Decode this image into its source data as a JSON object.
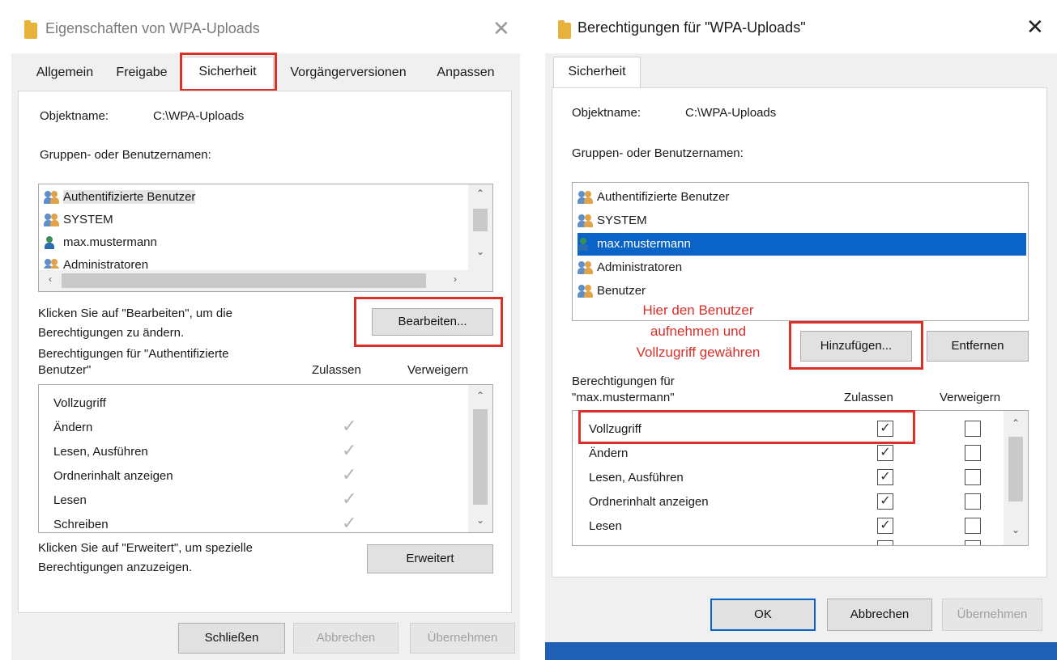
{
  "left_dialog": {
    "title": "Eigenschaften von WPA-Uploads",
    "tabs": [
      "Allgemein",
      "Freigabe",
      "Sicherheit",
      "Vorgängerversionen",
      "Anpassen"
    ],
    "object_label": "Objektname:",
    "object_value": "C:\\WPA-Uploads",
    "groups_label": "Gruppen- oder Benutzernamen:",
    "users": [
      "Authentifizierte Benutzer",
      "SYSTEM",
      "max.mustermann",
      "Administratoren"
    ],
    "edit_hint_1": "Klicken Sie auf \"Bearbeiten\", um die",
    "edit_hint_2": "Berechtigungen zu ändern.",
    "edit_button": "Bearbeiten...",
    "perm_for_1": "Berechtigungen für \"Authentifizierte",
    "perm_for_2": "Benutzer\"",
    "col_allow": "Zulassen",
    "col_deny": "Verweigern",
    "permissions": [
      "Vollzugriff",
      "Ändern",
      "Lesen, Ausführen",
      "Ordnerinhalt anzeigen",
      "Lesen",
      "Schreiben"
    ],
    "advanced_hint_1": "Klicken Sie auf \"Erweitert\", um spezielle",
    "advanced_hint_2": "Berechtigungen anzuzeigen.",
    "advanced_button": "Erweitert",
    "close_button": "Schließen",
    "cancel_button": "Abbrechen",
    "apply_button": "Übernehmen"
  },
  "right_dialog": {
    "title": "Berechtigungen für \"WPA-Uploads\"",
    "tab": "Sicherheit",
    "object_label": "Objektname:",
    "object_value": "C:\\WPA-Uploads",
    "groups_label": "Gruppen- oder Benutzernamen:",
    "users": [
      "Authentifizierte Benutzer",
      "SYSTEM",
      "max.mustermann",
      "Administratoren",
      "Benutzer"
    ],
    "annotation_1": "Hier den Benutzer",
    "annotation_2": "aufnehmen und",
    "annotation_3": "Vollzugriff gewähren",
    "add_button": "Hinzufügen...",
    "remove_button": "Entfernen",
    "perm_for_1": "Berechtigungen für",
    "perm_for_2": "\"max.mustermann\"",
    "col_allow": "Zulassen",
    "col_deny": "Verweigern",
    "permissions": [
      "Vollzugriff",
      "Ändern",
      "Lesen, Ausführen",
      "Ordnerinhalt anzeigen",
      "Lesen"
    ],
    "ok_button": "OK",
    "cancel_button": "Abbrechen",
    "apply_button": "Übernehmen"
  },
  "colors": {
    "accent": "#0a64c8",
    "highlight": "#d9302a",
    "taskbar": "#1f5fb5"
  }
}
